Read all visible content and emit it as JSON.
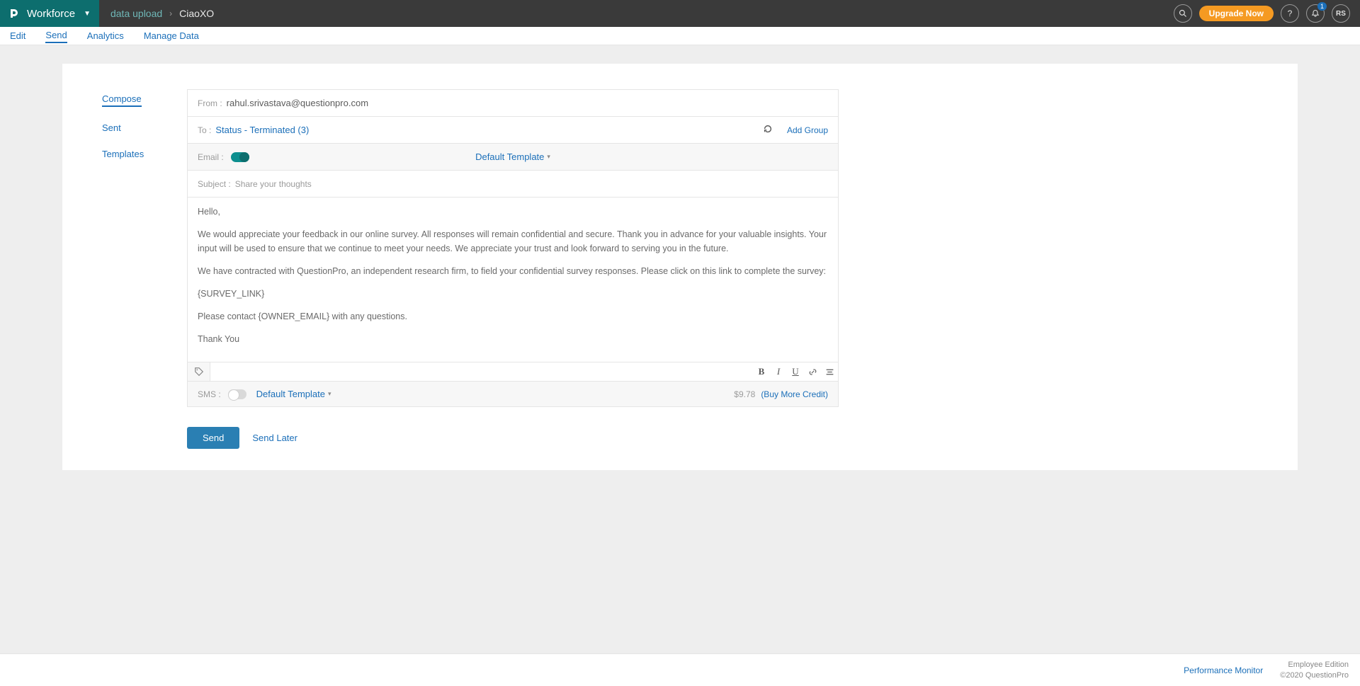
{
  "topbar": {
    "brand": "Workforce",
    "breadcrumb_parent": "data upload",
    "breadcrumb_child": "CiaoXO",
    "upgrade": "Upgrade Now",
    "notification_badge": "1",
    "avatar": "RS"
  },
  "subnav": [
    "Edit",
    "Send",
    "Analytics",
    "Manage Data"
  ],
  "side": {
    "compose": "Compose",
    "sent": "Sent",
    "templates": "Templates"
  },
  "compose": {
    "from_label": "From :",
    "from_value": "rahul.srivastava@questionpro.com",
    "to_label": "To :",
    "to_value": "Status - Terminated (3)",
    "add_group": "Add Group",
    "email_label": "Email :",
    "template": "Default Template",
    "subject_label": "Subject :",
    "subject_value": "Share your thoughts",
    "body": {
      "p1": "Hello,",
      "p2": "We would appreciate your feedback in our online survey.  All responses will remain confidential and secure.  Thank you in advance for your valuable insights.  Your input will be used to ensure that we continue to meet your needs. We appreciate your trust and look forward to serving you in the future.",
      "p3": "We have contracted with QuestionPro, an independent research firm, to field your confidential survey responses.  Please click on this link to complete the survey:",
      "p4": "{SURVEY_LINK}",
      "p5": "Please contact {OWNER_EMAIL} with any questions.",
      "p6": "Thank You"
    },
    "sms_label": "SMS :",
    "sms_template": "Default Template",
    "sms_credit": "$9.78",
    "sms_buy": "(Buy More Credit)"
  },
  "actions": {
    "send": "Send",
    "send_later": "Send Later"
  },
  "footer": {
    "perf": "Performance Monitor",
    "edition": "Employee Edition",
    "copyright": "©2020 QuestionPro"
  }
}
